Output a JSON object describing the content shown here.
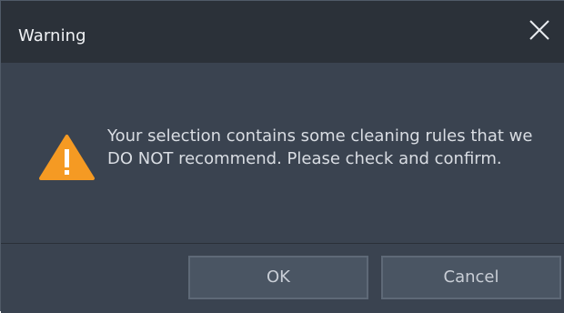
{
  "dialog": {
    "title": "Warning",
    "message": "Your selection contains some cleaning rules that we DO NOT recommend. Please check and confirm.",
    "icon": "warning-triangle",
    "buttons": {
      "ok_label": "OK",
      "cancel_label": "Cancel"
    }
  },
  "colors": {
    "titlebar_bg": "#2b3139",
    "body_bg": "#3a4350",
    "warning_icon": "#f59a23",
    "button_bg": "#4a5563"
  }
}
